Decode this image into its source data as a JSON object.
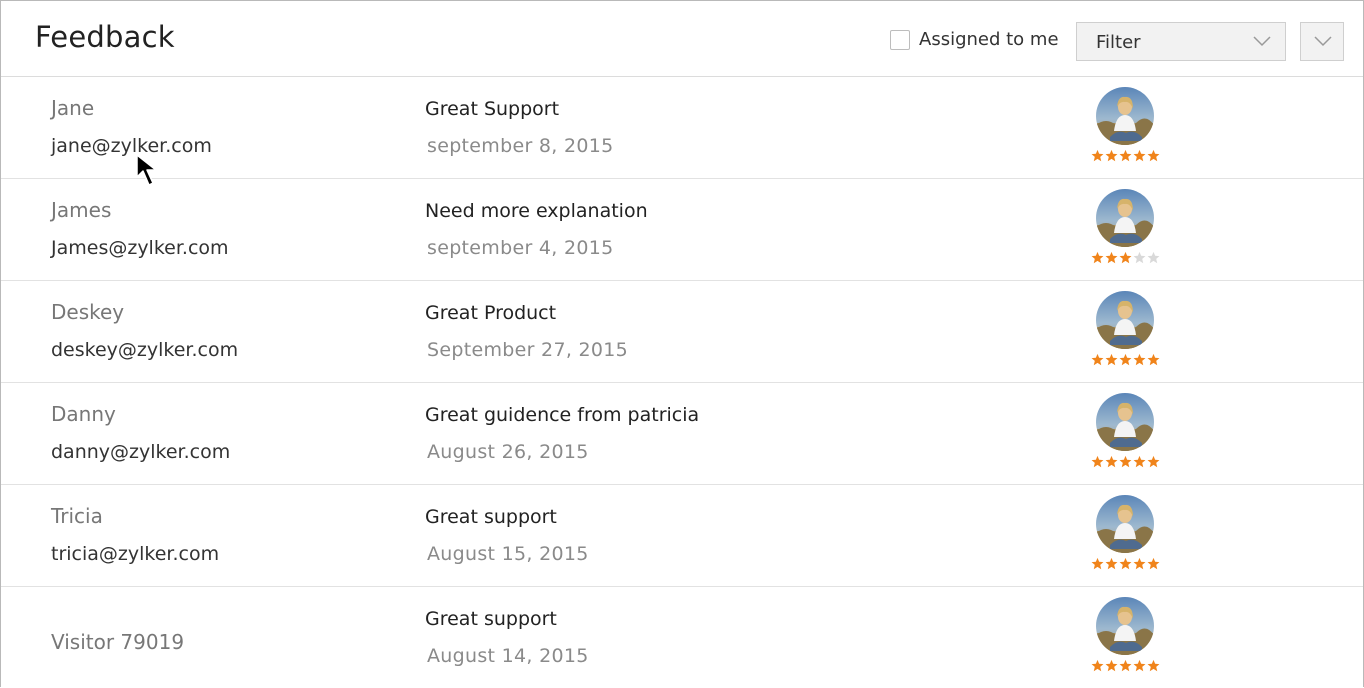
{
  "header": {
    "title": "Feedback",
    "assigned_label": "Assigned to me",
    "filter_label": "Filter"
  },
  "rows": [
    {
      "name": "Jane",
      "email": "jane@zylker.com",
      "subject": "Great Support",
      "date": "september 8, 2015",
      "rating": 5
    },
    {
      "name": "James",
      "email": "James@zylker.com",
      "subject": "Need more explanation",
      "date": "september 4, 2015",
      "rating": 3
    },
    {
      "name": "Deskey",
      "email": "deskey@zylker.com",
      "subject": "Great Product",
      "date": "September 27, 2015",
      "rating": 5
    },
    {
      "name": "Danny",
      "email": "danny@zylker.com",
      "subject": "Great guidence from patricia",
      "date": "August 26, 2015",
      "rating": 5
    },
    {
      "name": "Tricia",
      "email": "tricia@zylker.com",
      "subject": "Great support",
      "date": "August 15, 2015",
      "rating": 5
    },
    {
      "name": "Visitor 79019",
      "email": "",
      "subject": "Great support",
      "date": "August 14, 2015",
      "rating": 5
    }
  ],
  "colors": {
    "star_filled": "#f0841b",
    "star_empty": "#d9d9d9"
  },
  "icons": {
    "checkbox": "checkbox-icon",
    "dropdown": "chevron-down-icon",
    "rating": "star-icon",
    "cursor": "mouse-pointer-icon"
  }
}
